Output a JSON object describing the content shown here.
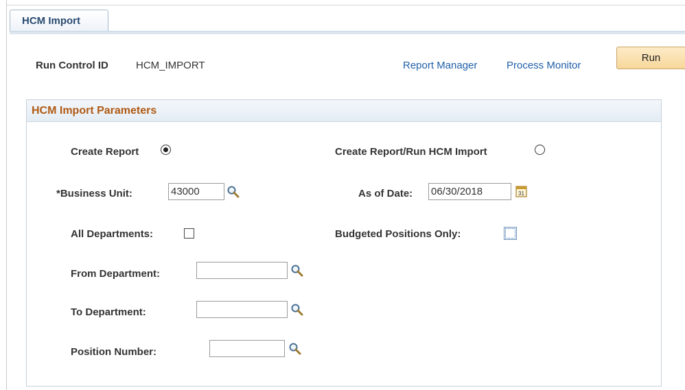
{
  "tab": {
    "label": "HCM Import"
  },
  "header": {
    "run_control_label": "Run Control ID",
    "run_control_value": "HCM_IMPORT",
    "report_manager_link": "Report Manager",
    "process_monitor_link": "Process Monitor",
    "run_button": "Run"
  },
  "params": {
    "title": "HCM Import Parameters",
    "create_report_label": "Create Report",
    "create_report_selected": true,
    "create_run_label": "Create Report/Run HCM Import",
    "create_run_selected": false,
    "business_unit_label": "*Business Unit:",
    "business_unit_value": "43000",
    "as_of_date_label": "As of Date:",
    "as_of_date_value": "06/30/2018",
    "calendar_day": "31",
    "all_departments_label": "All Departments:",
    "all_departments_checked": false,
    "budgeted_positions_label": "Budgeted Positions Only:",
    "budgeted_positions_checked": false,
    "from_department_label": "From Department:",
    "from_department_value": "",
    "to_department_label": "To Department:",
    "to_department_value": "",
    "position_number_label": "Position Number:",
    "position_number_value": ""
  },
  "colors": {
    "link": "#1f5fa8",
    "group_title": "#b05a13",
    "run_button": "#f8d79a"
  }
}
